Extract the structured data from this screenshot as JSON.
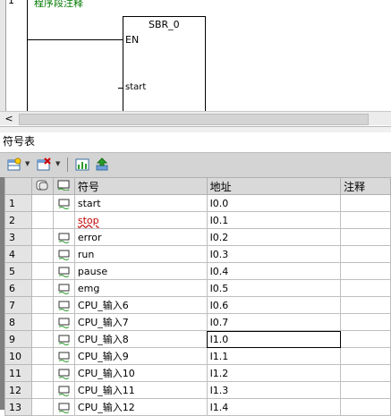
{
  "editor": {
    "network_number": "1",
    "network_comment": "程序段注释",
    "sbr_title": "SBR_0",
    "pin_en": "EN",
    "pin_start": "start"
  },
  "scrollbar": {
    "left_arrow": "<"
  },
  "panel": {
    "title": "符号表"
  },
  "toolbar": {
    "icons": [
      "table-insert-icon",
      "dropdown-arrow-icon",
      "table-delete-icon",
      "dropdown-arrow-icon",
      "chart-icon",
      "download-icon"
    ]
  },
  "table": {
    "headers": {
      "symbol": "符号",
      "address": "地址",
      "comment": "注释"
    },
    "rows": [
      {
        "num": "1",
        "icon": true,
        "symbol": "start",
        "address": "I0.0",
        "error": false
      },
      {
        "num": "2",
        "icon": false,
        "symbol": "stop",
        "address": "I0.1",
        "error": true
      },
      {
        "num": "3",
        "icon": true,
        "symbol": "error",
        "address": "I0.2",
        "error": false
      },
      {
        "num": "4",
        "icon": true,
        "symbol": "run",
        "address": "I0.3",
        "error": false
      },
      {
        "num": "5",
        "icon": true,
        "symbol": "pause",
        "address": "I0.4",
        "error": false
      },
      {
        "num": "6",
        "icon": true,
        "symbol": "emg",
        "address": "I0.5",
        "error": false
      },
      {
        "num": "7",
        "icon": true,
        "symbol": "CPU_输入6",
        "address": "I0.6",
        "error": false
      },
      {
        "num": "8",
        "icon": true,
        "symbol": "CPU_输入7",
        "address": "I0.7",
        "error": false
      },
      {
        "num": "9",
        "icon": true,
        "symbol": "CPU_输入8",
        "address": "I1.0",
        "error": false,
        "selected": true
      },
      {
        "num": "10",
        "icon": true,
        "symbol": "CPU_输入9",
        "address": "I1.1",
        "error": false
      },
      {
        "num": "11",
        "icon": true,
        "symbol": "CPU_输入10",
        "address": "I1.2",
        "error": false
      },
      {
        "num": "12",
        "icon": true,
        "symbol": "CPU_输入11",
        "address": "I1.3",
        "error": false
      },
      {
        "num": "13",
        "icon": true,
        "symbol": "CPU_输入12",
        "address": "I1.4",
        "error": false
      }
    ]
  },
  "colors": {
    "comment_green": "#007a00",
    "error_red": "#c00000",
    "grid_gray": "#808080"
  }
}
